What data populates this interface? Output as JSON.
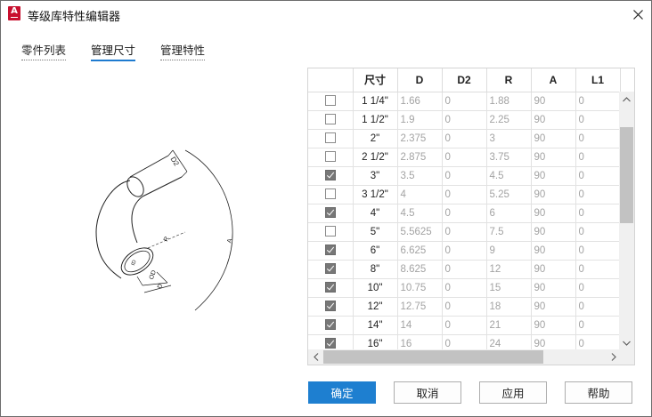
{
  "window": {
    "title": "等级库特性编辑器"
  },
  "tabs": [
    {
      "label": "零件列表"
    },
    {
      "label": "管理尺寸"
    },
    {
      "label": "管理特性"
    }
  ],
  "preview_labels": {
    "d2": "D2",
    "r": "R",
    "a": "A",
    "od": "OD",
    "id": "ID",
    "d": "D"
  },
  "grid": {
    "columns": [
      "",
      "尺寸",
      "D",
      "D2",
      "R",
      "A",
      "L1"
    ],
    "rows": [
      {
        "checked": false,
        "size": "1 1/4\"",
        "D": "1.66",
        "D2": "0",
        "R": "1.88",
        "A": "90",
        "L1": "0"
      },
      {
        "checked": false,
        "size": "1 1/2\"",
        "D": "1.9",
        "D2": "0",
        "R": "2.25",
        "A": "90",
        "L1": "0"
      },
      {
        "checked": false,
        "size": "2\"",
        "D": "2.375",
        "D2": "0",
        "R": "3",
        "A": "90",
        "L1": "0"
      },
      {
        "checked": false,
        "size": "2 1/2\"",
        "D": "2.875",
        "D2": "0",
        "R": "3.75",
        "A": "90",
        "L1": "0"
      },
      {
        "checked": true,
        "size": "3\"",
        "D": "3.5",
        "D2": "0",
        "R": "4.5",
        "A": "90",
        "L1": "0"
      },
      {
        "checked": false,
        "size": "3 1/2\"",
        "D": "4",
        "D2": "0",
        "R": "5.25",
        "A": "90",
        "L1": "0"
      },
      {
        "checked": true,
        "size": "4\"",
        "D": "4.5",
        "D2": "0",
        "R": "6",
        "A": "90",
        "L1": "0"
      },
      {
        "checked": false,
        "size": "5\"",
        "D": "5.5625",
        "D2": "0",
        "R": "7.5",
        "A": "90",
        "L1": "0"
      },
      {
        "checked": true,
        "size": "6\"",
        "D": "6.625",
        "D2": "0",
        "R": "9",
        "A": "90",
        "L1": "0"
      },
      {
        "checked": true,
        "size": "8\"",
        "D": "8.625",
        "D2": "0",
        "R": "12",
        "A": "90",
        "L1": "0"
      },
      {
        "checked": true,
        "size": "10\"",
        "D": "10.75",
        "D2": "0",
        "R": "15",
        "A": "90",
        "L1": "0"
      },
      {
        "checked": true,
        "size": "12\"",
        "D": "12.75",
        "D2": "0",
        "R": "18",
        "A": "90",
        "L1": "0"
      },
      {
        "checked": true,
        "size": "14\"",
        "D": "14",
        "D2": "0",
        "R": "21",
        "A": "90",
        "L1": "0"
      },
      {
        "checked": true,
        "size": "16\"",
        "D": "16",
        "D2": "0",
        "R": "24",
        "A": "90",
        "L1": "0"
      }
    ]
  },
  "buttons": {
    "ok": "确定",
    "cancel": "取消",
    "apply": "应用",
    "help": "帮助"
  },
  "colors": {
    "accent": "#1e7fd0",
    "brand": "#c8102e"
  }
}
